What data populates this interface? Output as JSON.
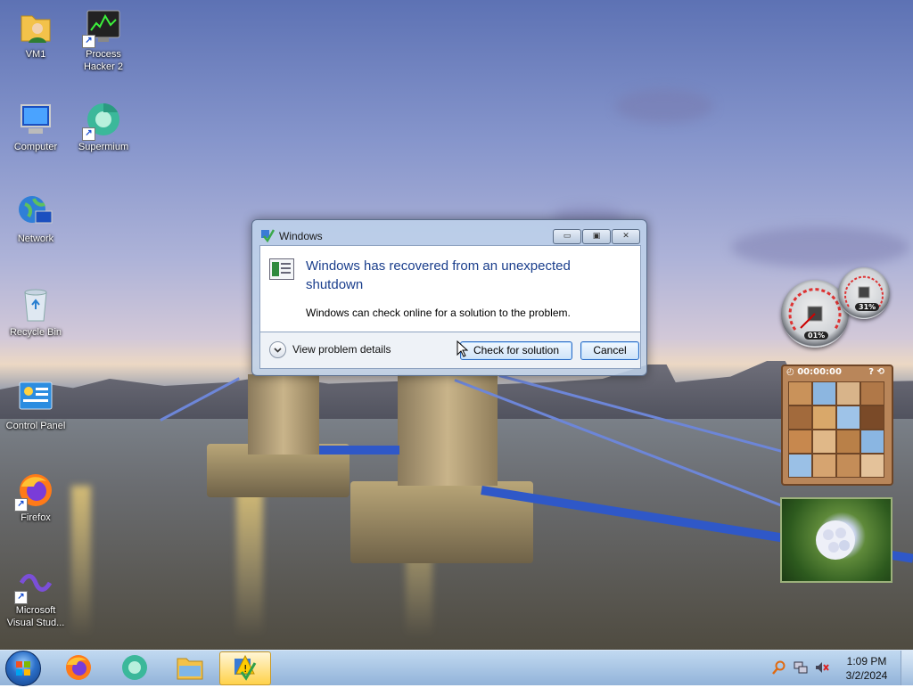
{
  "desktop": {
    "icons": [
      {
        "label": "VM1"
      },
      {
        "label": "Process\nHacker 2"
      },
      {
        "label": "Computer"
      },
      {
        "label": "Supermium"
      },
      {
        "label": "Network"
      },
      {
        "label": "Recycle Bin"
      },
      {
        "label": "Control Panel"
      },
      {
        "label": "Firefox"
      },
      {
        "label": "Microsoft\nVisual Stud..."
      }
    ]
  },
  "dialog": {
    "title": "Windows",
    "heading": "Windows has recovered from an unexpected shutdown",
    "subtext": "Windows can check online for a solution to the problem.",
    "details_label": "View problem details",
    "primary_button": "Check for solution",
    "cancel_button": "Cancel"
  },
  "gadgets": {
    "cpu_gauge": {
      "value": "01%"
    },
    "memory_gauge": {
      "value": "31%"
    },
    "puzzle_timer": "00:00:00"
  },
  "taskbar": {
    "pinned": [
      "firefox-icon",
      "supermium-icon",
      "file-explorer-icon",
      "windows-action-center-icon"
    ],
    "clock_time": "1:09 PM",
    "clock_date": "3/2/2024"
  },
  "colors": {
    "dialog_heading": "#1a3e8c",
    "button_border": "#2b6bc4",
    "taskbar_active": "#ffd24a"
  }
}
